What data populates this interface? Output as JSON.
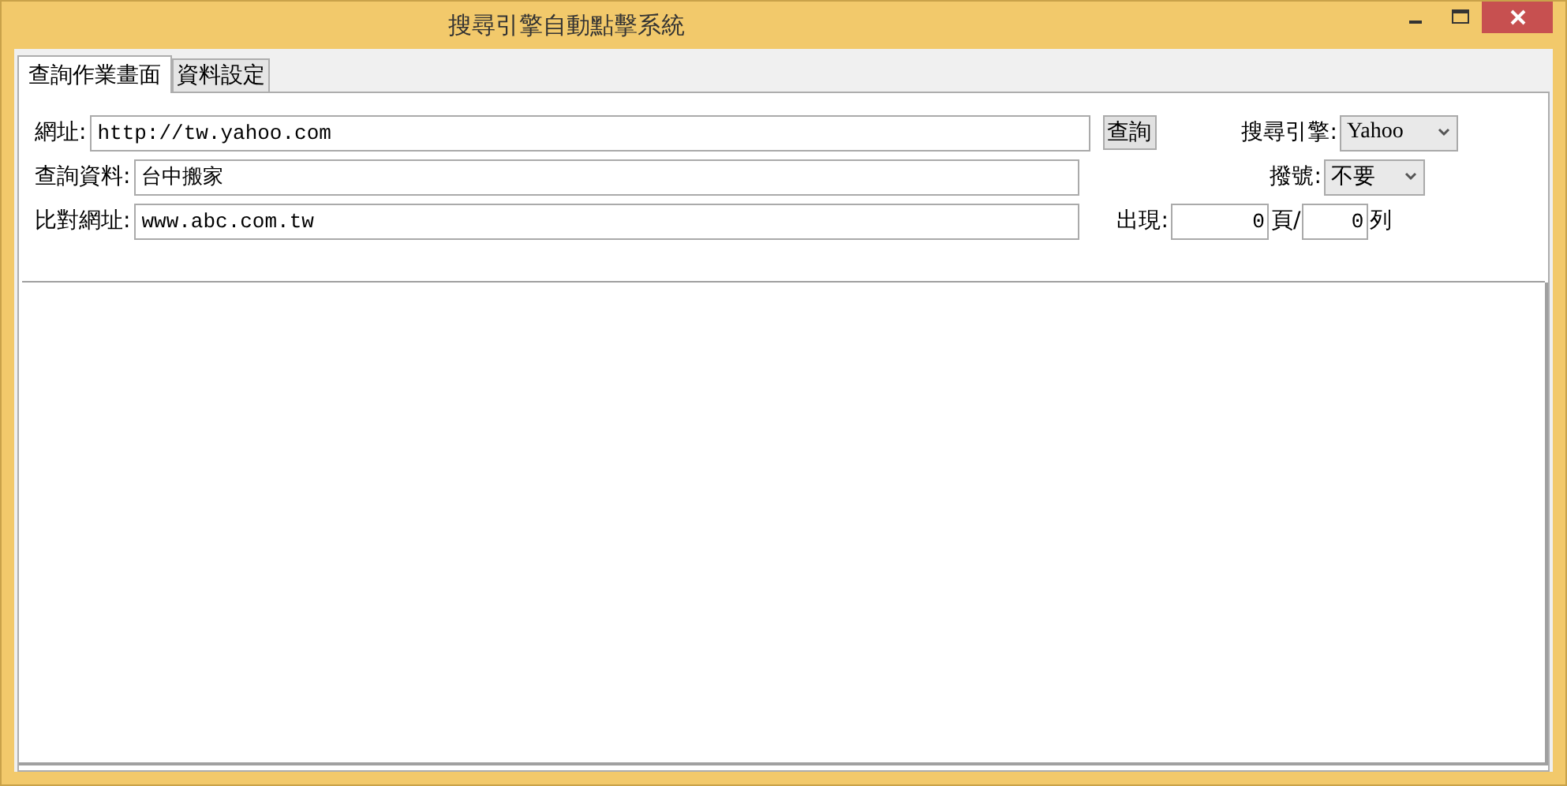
{
  "window": {
    "title": "搜尋引擎自動點擊系統"
  },
  "tabs": [
    {
      "label": "查詢作業畫面",
      "selected": true
    },
    {
      "label": "資料設定",
      "selected": false
    }
  ],
  "fields": [
    {
      "label": "網址:",
      "value": "http://tw.yahoo.com"
    },
    {
      "label": "查詢資料:",
      "value": "台中搬家"
    },
    {
      "label": "比對網址:",
      "value": "www.abc.com.tw"
    }
  ],
  "query_button": "查詢",
  "engine": {
    "label": "搜尋引擎:",
    "value": "Yahoo"
  },
  "dialup": {
    "label": "撥號:",
    "value": "不要"
  },
  "position": {
    "label": "出現:",
    "page": "0",
    "page_unit": "頁/",
    "row": "0",
    "row_unit": "列"
  }
}
